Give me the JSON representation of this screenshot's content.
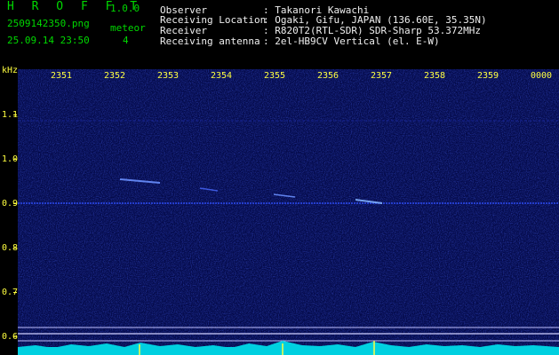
{
  "app": {
    "logo": "H R O F F T",
    "version": "1.0.0"
  },
  "file": {
    "name": "2509142350.png",
    "timestamp": "25.09.14 23:50"
  },
  "meteor": {
    "label": "meteor",
    "count": "4"
  },
  "info": [
    {
      "label": "Observer",
      "value": ": Takanori Kawachi"
    },
    {
      "label": "Receiving Location",
      "value": ": Ogaki, Gifu, JAPAN (136.60E, 35.35N)"
    },
    {
      "label": "Receiver",
      "value": ": R820T2(RTL-SDR) SDR-Sharp 53.372MHz"
    },
    {
      "label": "Receiving antenna",
      "value": ": 2el-HB9CV Vertical (el. E-W)"
    }
  ],
  "time_axis": [
    "2351",
    "2352",
    "2353",
    "2354",
    "2355",
    "2356",
    "2357",
    "2358",
    "2359",
    "0000"
  ],
  "freq_axis": {
    "unit": "kHz",
    "labels": [
      "1.1",
      "1.0",
      "0.9",
      "0.8",
      "0.7",
      "0.6"
    ]
  },
  "colors": {
    "header_green": "#00d800",
    "axis_yellow": "#ffff40",
    "background": "#040a4a"
  }
}
